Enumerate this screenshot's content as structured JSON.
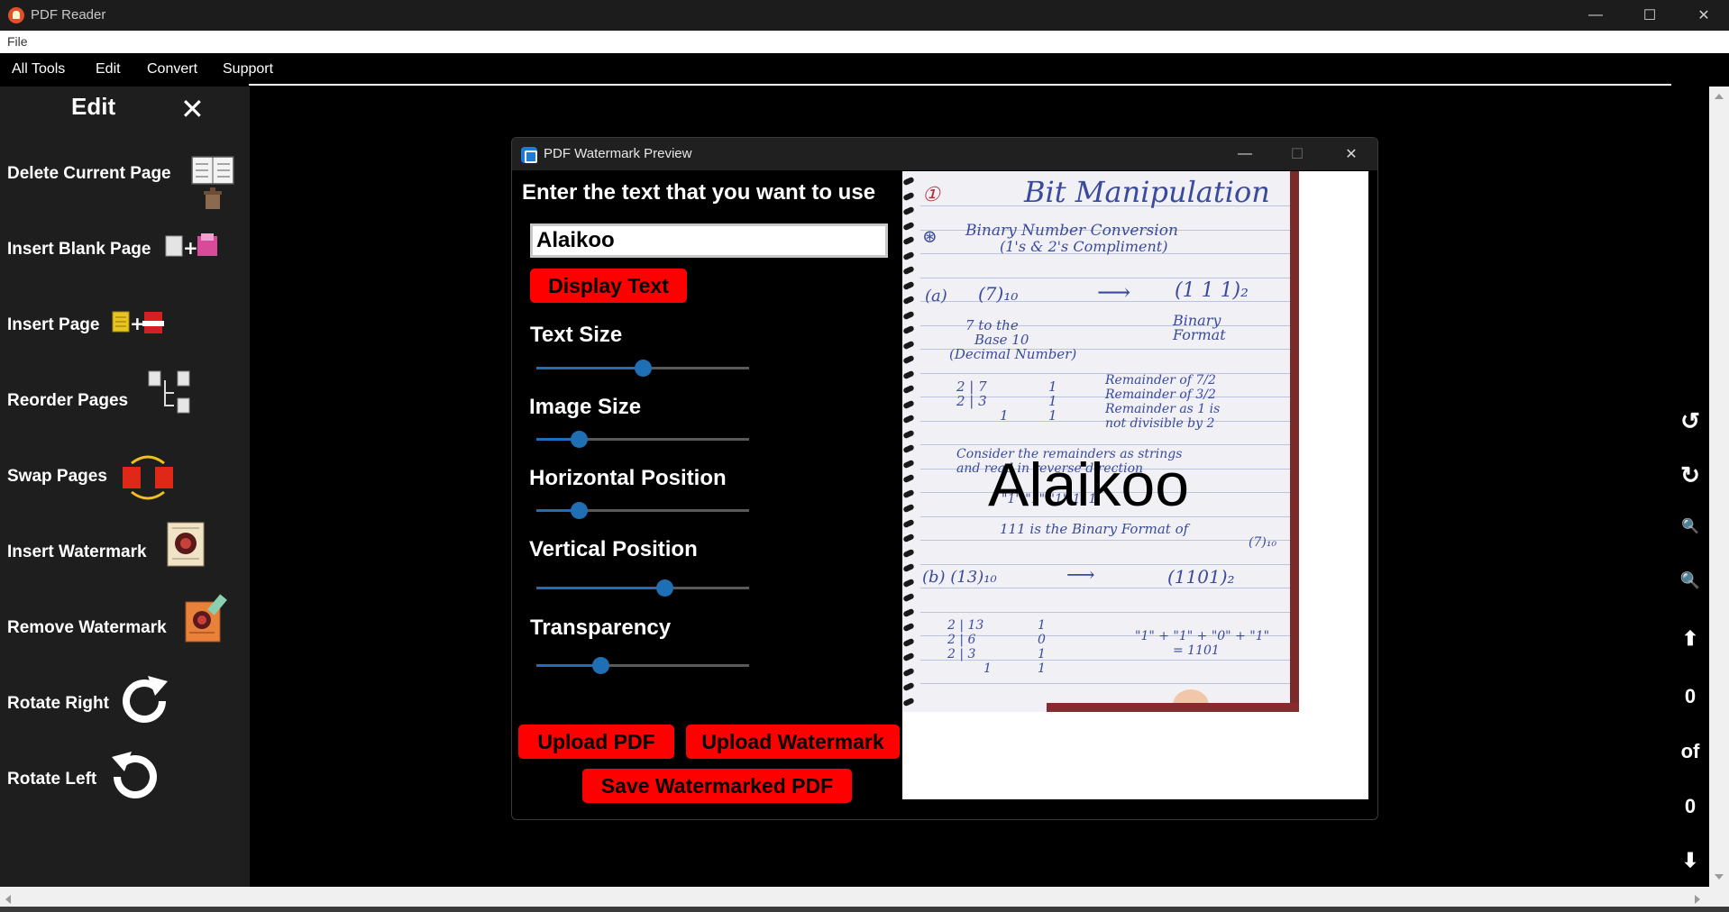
{
  "window": {
    "title": "PDF Reader",
    "minimize_icon": "minimize-icon",
    "maximize_icon": "maximize-icon",
    "close_icon": "close-icon"
  },
  "menubar": {
    "file": "File"
  },
  "toolbar": {
    "items": [
      "All Tools",
      "Edit",
      "Convert",
      "Support"
    ]
  },
  "edit_panel": {
    "title": "Edit",
    "close_glyph": "✕",
    "items": [
      {
        "label": "Delete Current Page",
        "icon": "delete-page-icon"
      },
      {
        "label": "Insert Blank Page",
        "icon": "insert-blank-page-icon"
      },
      {
        "label": "Insert Page",
        "icon": "insert-page-icon"
      },
      {
        "label": "Reorder Pages",
        "icon": "reorder-pages-icon"
      },
      {
        "label": "Swap Pages",
        "icon": "swap-pages-icon"
      },
      {
        "label": "Insert Watermark",
        "icon": "insert-watermark-icon"
      },
      {
        "label": "Remove Watermark",
        "icon": "remove-watermark-icon"
      },
      {
        "label": "Rotate Right",
        "icon": "rotate-right-icon"
      },
      {
        "label": "Rotate Left",
        "icon": "rotate-left-icon"
      }
    ]
  },
  "right_strip": {
    "rotate_left_glyph": "↺",
    "rotate_right_glyph": "↻",
    "zoom_out_glyph": "🔍",
    "zoom_in_glyph": "🔍",
    "up_glyph": "⬆",
    "down_glyph": "⬇",
    "current_page": "0",
    "of_label": "of",
    "total_pages": "0"
  },
  "dialog": {
    "title": "PDF Watermark Preview",
    "prompt": "Enter the text that you want to use",
    "input_value": "Alaikoo",
    "display_text_button": "Display Text",
    "sliders": [
      {
        "label": "Text Size",
        "value": 0.5
      },
      {
        "label": "Image Size",
        "value": 0.2
      },
      {
        "label": "Horizontal Position",
        "value": 0.2
      },
      {
        "label": "Vertical Position",
        "value": 0.6
      },
      {
        "label": "Transparency",
        "value": 0.3
      }
    ],
    "upload_pdf_button": "Upload PDF",
    "upload_watermark_button": "Upload Watermark",
    "save_button": "Save Watermarked PDF",
    "preview": {
      "watermark_text": "Alaikoo",
      "notes": [
        "①",
        "Bit  Manipulation",
        "⊛",
        "Binary  Number  Conversion",
        "(1's & 2's  Compliment)",
        "(a)",
        "(7)₁₀",
        "⟶",
        "(1 1 1)₂",
        "7  to  the",
        "Base  10",
        "(Decimal  Number)",
        "Binary",
        "Format",
        "2 | 7",
        "2 | 3",
        "1",
        "1",
        "1",
        "1",
        "Remainder  of  7/2",
        "Remainder  of  3/2",
        "Remainder  as  1 is",
        "not  divisible  by  2",
        "Consider  the  remainders  as  strings",
        "and  read  in  reverse  direction",
        "\"1\"  \"1\"  \"1\"  111",
        "111  is  the  Binary  Format  of",
        "(7)₁₀",
        "(b) (13)₁₀",
        "⟶",
        "(1101)₂",
        "2 | 13",
        "2 | 6",
        "2 | 3",
        "1",
        "1",
        "0",
        "1",
        "1",
        "\"1\" + \"1\" + \"0\" + \"1\"",
        "= 1101"
      ]
    }
  },
  "colors": {
    "accent_red": "#ff0000",
    "slider_blue": "#1f6fb5",
    "panel_bg": "#1e1e1e"
  }
}
